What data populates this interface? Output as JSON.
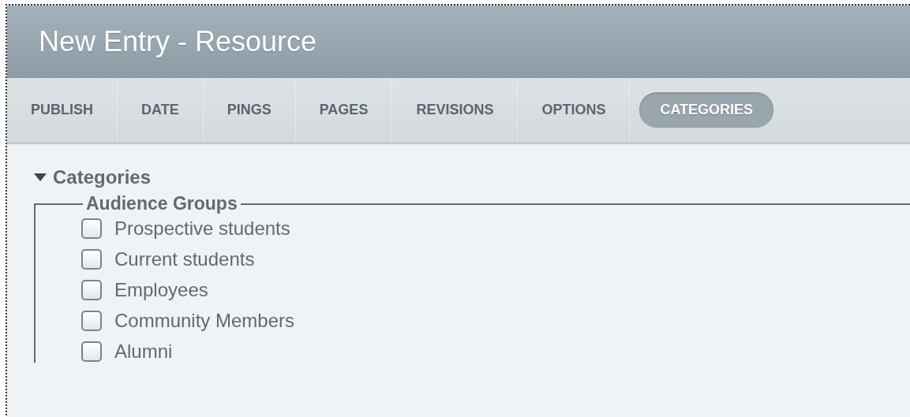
{
  "window": {
    "title": "New Entry - Resource"
  },
  "tabs": [
    {
      "label": "PUBLISH",
      "selected": false
    },
    {
      "label": "DATE",
      "selected": false
    },
    {
      "label": "PINGS",
      "selected": false
    },
    {
      "label": "PAGES",
      "selected": false
    },
    {
      "label": "REVISIONS",
      "selected": false
    },
    {
      "label": "OPTIONS",
      "selected": false
    },
    {
      "label": "CATEGORIES",
      "selected": true
    }
  ],
  "section": {
    "title": "Categories",
    "expanded": true,
    "group": {
      "legend": "Audience Groups",
      "options": [
        {
          "label": "Prospective students",
          "checked": false
        },
        {
          "label": "Current students",
          "checked": false
        },
        {
          "label": "Employees",
          "checked": false
        },
        {
          "label": "Community Members",
          "checked": false
        },
        {
          "label": "Alumni",
          "checked": false
        }
      ]
    }
  }
}
